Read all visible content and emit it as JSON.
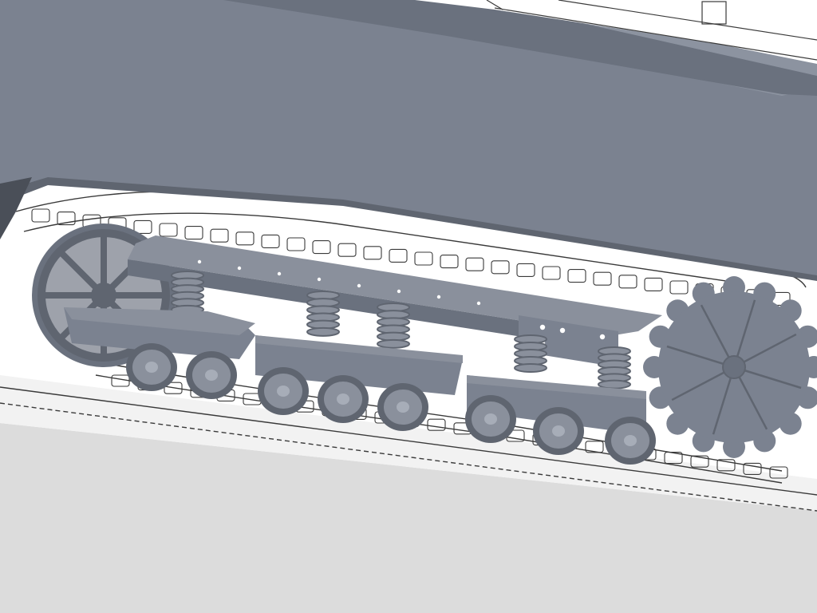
{
  "scene": {
    "subject": "3d-render-tank-suspension",
    "colors": {
      "hull": "#7b8290",
      "hull_shadow": "#6a717e",
      "hull_highlight": "#8c93a0",
      "metal": "#8a909c",
      "metal_dark": "#5f6570",
      "metal_light": "#a7adb8",
      "blueprint_line": "#3a3a3a",
      "blueprint_bg": "#f4f4f4",
      "floor": "#dcdcdc",
      "white": "#ffffff"
    },
    "counts": {
      "front_bogie_rollers": 2,
      "middle_bogie_rollers": 3,
      "rear_bogie_rollers": 3,
      "coil_springs": 6,
      "sprocket_teeth": 16,
      "idler_spokes": 8
    }
  }
}
